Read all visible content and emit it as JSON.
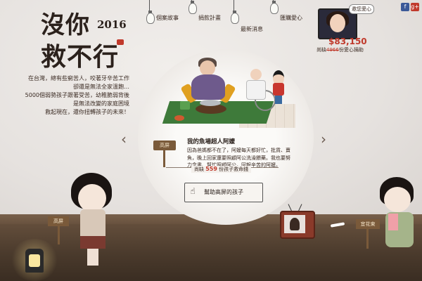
{
  "brand": {
    "logo_line1": "沒你",
    "logo_line2": "救不行",
    "year": "2016"
  },
  "intro": [
    "在台灣，總有些窮苦人，咬著牙辛苦工作",
    "卻還是無法全家溫飽…",
    "5000個弱勢孩子跟著受苦，幼稚脆弱背後",
    "是無法改變的家庭困境",
    "救起現在，還你扭轉孩子的未來！"
  ],
  "nav": [
    {
      "label": "個案故事"
    },
    {
      "label": "捐款計畫"
    },
    {
      "label": "最新消息"
    },
    {
      "label": "匯購愛心"
    }
  ],
  "share": {
    "facebook": "f",
    "google": "g+"
  },
  "spokesperson": {
    "bubble": "邀您愛心",
    "amount": "$83,150",
    "label_prefix": "尚缺",
    "label_strike": "4966",
    "label_suffix": "份愛心捐助"
  },
  "story": {
    "location": "高屏",
    "title": "我的魚場超人阿嬤",
    "text": "因為爸媽都不在了，阿嬤每天都好忙，批貨、賣魚，晚上回家還要照顧阿公洗澡餵藥。我也要努力念書、幫忙照顧阿公，回報辛苦的阿嬤。",
    "saved_prefix": "尚缺",
    "saved_count": "559",
    "saved_suffix": "份孩子救命錢",
    "help_button": "幫助高屏的孩子"
  },
  "arrows": {
    "prev": "‹",
    "next": "›"
  },
  "signs": {
    "left": "高屏",
    "right": "宜花東"
  },
  "colors": {
    "accent": "#c0392b",
    "wall": "#e9e5e2",
    "floor": "#5a4432"
  }
}
